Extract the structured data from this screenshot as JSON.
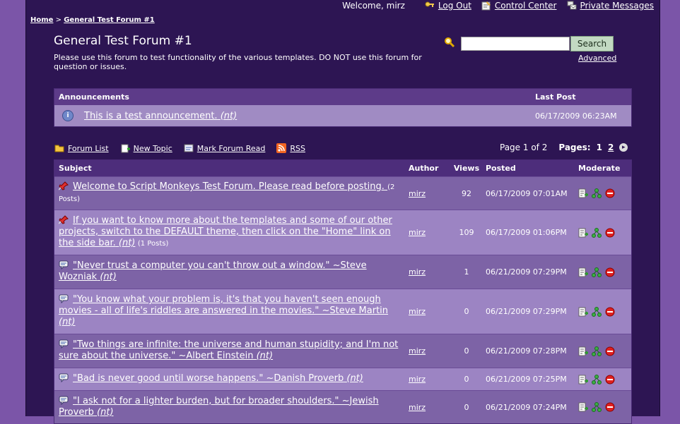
{
  "topbar": {
    "welcome": "Welcome, mirz",
    "logout": "Log Out",
    "control_center": "Control Center",
    "private_messages": "Private Messages"
  },
  "breadcrumb": {
    "home": "Home",
    "sep": " > ",
    "current": "General Test Forum #1"
  },
  "forum": {
    "title": "General Test Forum #1",
    "description": "Please use this forum to test functionality of the various templates. DO NOT use this forum for question or issues."
  },
  "search": {
    "button": "Search",
    "advanced": "Advanced",
    "value": ""
  },
  "announcements": {
    "header_subject": "Announcements",
    "header_last_post": "Last Post",
    "item": {
      "title": "This is a test announcement.",
      "nt": "(nt)",
      "date": "06/17/2009 06:23AM"
    }
  },
  "tools": {
    "forum_list": "Forum List",
    "new_topic": "New Topic",
    "mark_read": "Mark Forum Read",
    "rss": "RSS"
  },
  "pager": {
    "status": "Page 1 of 2",
    "label": "Pages:",
    "page1": "1",
    "page2": "2"
  },
  "topics": {
    "headers": {
      "subject": "Subject",
      "author": "Author",
      "views": "Views",
      "posted": "Posted",
      "moderate": "Moderate"
    },
    "rows": [
      {
        "title": "Welcome to Script Monkeys Test Forum. Please read before posting.",
        "nt": "",
        "posts": "(2 Posts)",
        "author": "mirz",
        "views": "92",
        "posted": "06/17/2009 07:01AM"
      },
      {
        "title": "If you want to know more about the templates and some of our other projects, switch to the DEFAULT theme, then click on the \"Home\" link on the side bar.",
        "nt": "(nt)",
        "posts": "(1 Posts)",
        "author": "mirz",
        "views": "109",
        "posted": "06/17/2009 01:06PM"
      },
      {
        "title": "\"Never trust a computer you can't throw out a window.\" ~Steve Wozniak",
        "nt": "(nt)",
        "posts": "",
        "author": "mirz",
        "views": "1",
        "posted": "06/21/2009 07:29PM"
      },
      {
        "title": "\"You know what your problem is, it's that you haven't seen enough movies - all of life's riddles are answered in the movies.\" ~Steve Martin",
        "nt": "(nt)",
        "posts": "",
        "author": "mirz",
        "views": "0",
        "posted": "06/21/2009 07:29PM"
      },
      {
        "title": "\"Two things are infinite: the universe and human stupidity; and I'm not sure about the universe.\" ~Albert Einstein",
        "nt": "(nt)",
        "posts": "",
        "author": "mirz",
        "views": "0",
        "posted": "06/21/2009 07:28PM"
      },
      {
        "title": "\"Bad is never good until worse happens.\" ~Danish Proverb",
        "nt": "(nt)",
        "posts": "",
        "author": "mirz",
        "views": "0",
        "posted": "06/21/2009 07:25PM"
      },
      {
        "title": "\"I ask not for a lighter burden, but for broader shoulders.\" ~Jewish Proverb",
        "nt": "(nt)",
        "posts": "",
        "author": "mirz",
        "views": "0",
        "posted": "06/21/2009 07:24PM"
      }
    ]
  }
}
